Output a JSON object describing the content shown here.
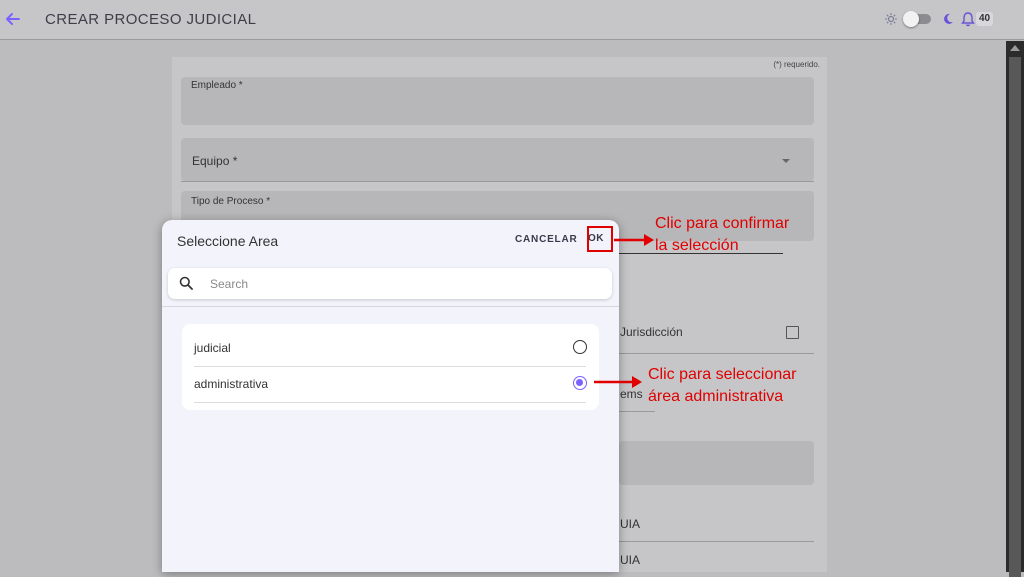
{
  "header": {
    "title": "CREAR PROCESO JUDICIAL",
    "notification_count": "40"
  },
  "form": {
    "required_note": "(*) requerido.",
    "fields": {
      "empleado": "Empleado *",
      "equipo": "Equipo *",
      "tipo_proceso": "Tipo de Proceso *"
    },
    "partial_texts": {
      "jurisdiccion": "Jurisdicción",
      "items": "ems",
      "guia_1": "UIA",
      "guia_2": "UIA"
    }
  },
  "modal": {
    "title": "Seleccione Area",
    "cancel_label": "CANCELAR",
    "ok_label": "OK",
    "search_placeholder": "Search",
    "options": [
      {
        "label": "judicial",
        "selected": false
      },
      {
        "label": "administrativa",
        "selected": true
      }
    ]
  },
  "annotations": {
    "confirm": "Clic para confirmar\nla selección",
    "select": "Clic para seleccionar\nárea administrativa"
  },
  "colors": {
    "accent": "#7b61ff",
    "annotation": "#e00000",
    "overlay": "#bcbcbe"
  },
  "icons": [
    "arrow-left-icon",
    "sun-icon",
    "moon-icon",
    "bell-icon",
    "search-icon",
    "chevron-down-icon"
  ]
}
